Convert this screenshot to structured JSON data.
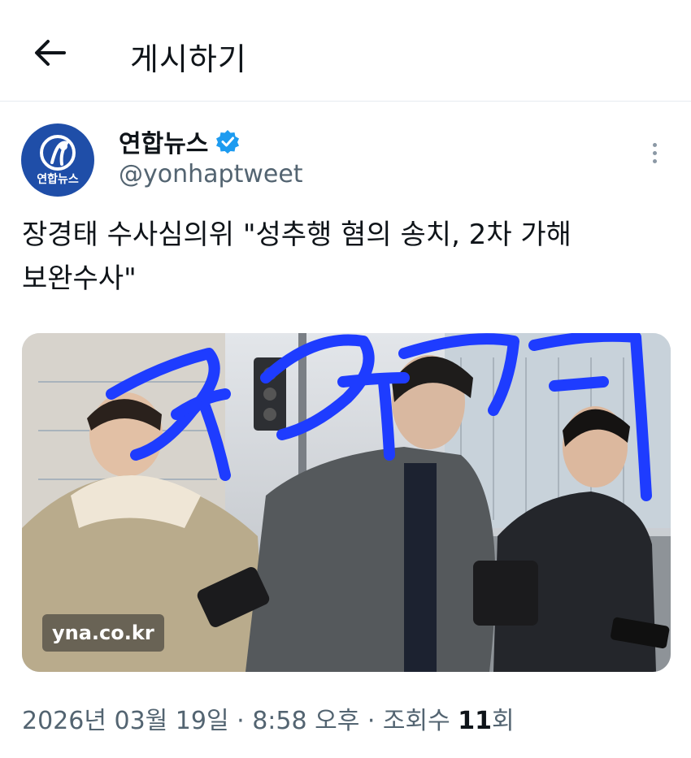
{
  "header": {
    "back_icon": "arrow-left-icon",
    "title": "게시하기"
  },
  "author": {
    "avatar_text": "연합뉴스",
    "display_name": "연합뉴스",
    "verified_icon": "verified-badge-icon",
    "handle": "@yonhaptweet"
  },
  "tweet": {
    "text_line1": "장경태 수사심의위 \"성추행 혐의 송치, 2차 가해",
    "text_line2": "보완수사\"",
    "media_watermark": "yna.co.kr",
    "media_scribble_color": "#1e3cff"
  },
  "meta": {
    "date": "2026년 03월 19일",
    "sep1": " · ",
    "time": "8:58 오후",
    "sep2": " · ",
    "views_label": "조회수 ",
    "views_count": "11",
    "views_unit": "회"
  },
  "colors": {
    "primary_text": "#0f1419",
    "secondary_text": "#536471",
    "verified": "#1d9bf0",
    "avatar_bg": "#1f4ea8"
  }
}
